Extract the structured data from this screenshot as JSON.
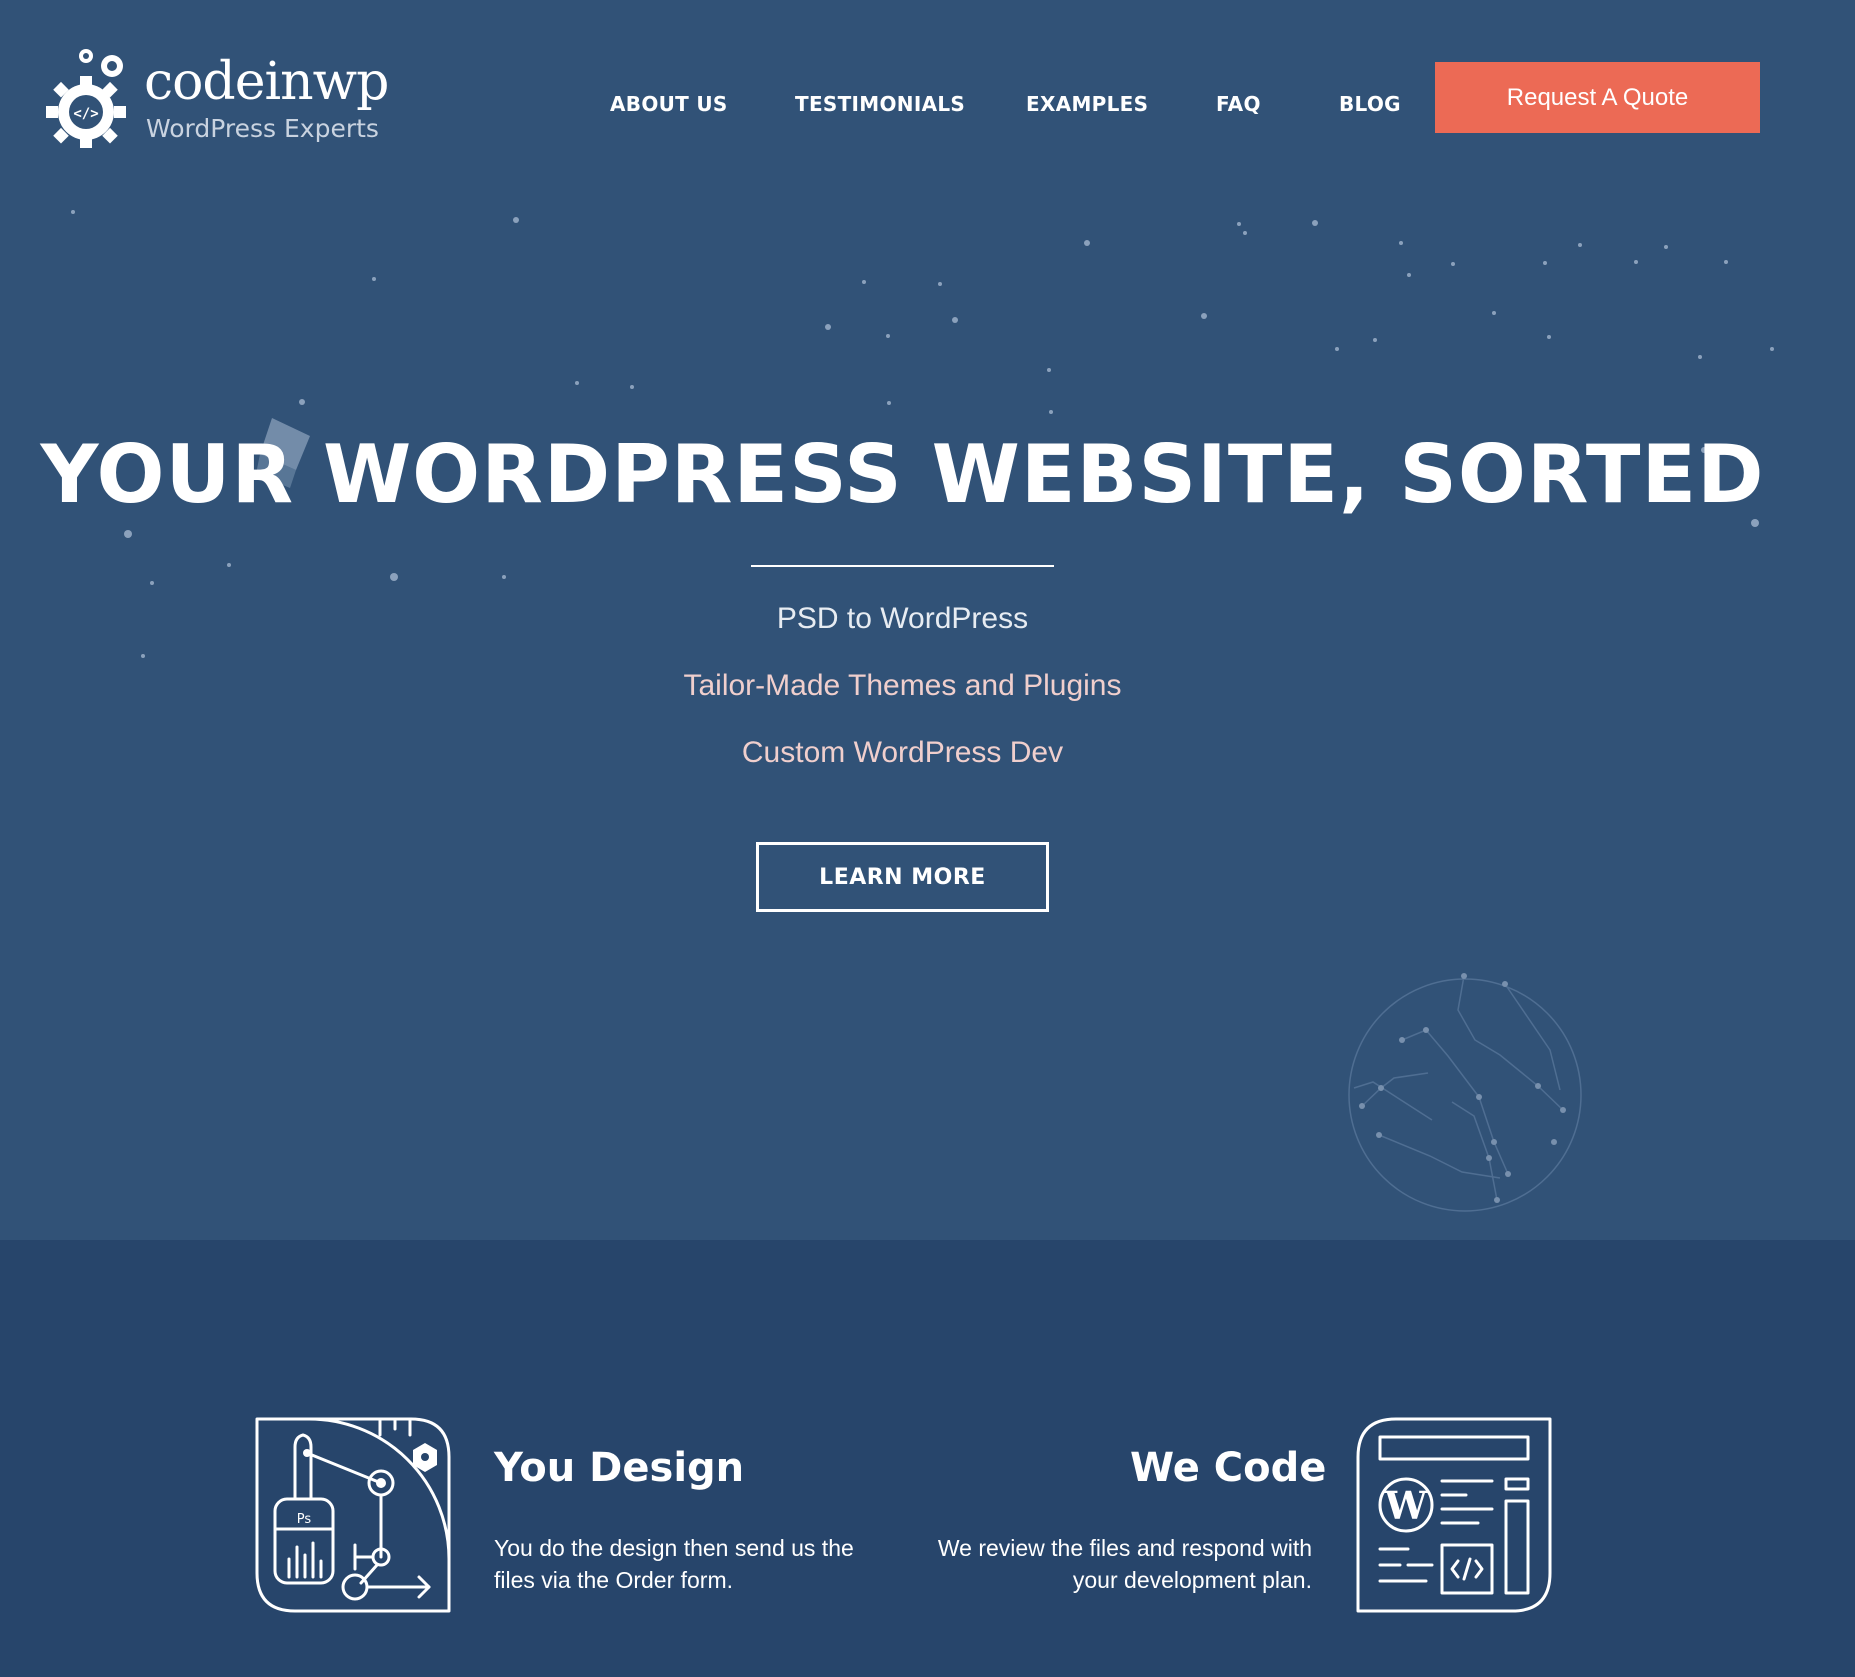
{
  "brand": {
    "name": "codeinwp",
    "tagline": "WordPress Experts"
  },
  "nav": {
    "items": [
      "ABOUT US",
      "TESTIMONIALS",
      "EXAMPLES",
      "FAQ",
      "BLOG"
    ],
    "cta_label": "Request A Quote"
  },
  "hero": {
    "title": "YOUR WORDPRESS WEBSITE, SORTED",
    "services": [
      "PSD to WordPress",
      "Tailor-Made Themes and Plugins",
      "Custom WordPress Dev"
    ],
    "button_label": "LEARN MORE"
  },
  "features": [
    {
      "title": "You Design",
      "text": "You do the design then send us the files via the Order form.",
      "icon": "design-tools-icon"
    },
    {
      "title": "We Code",
      "text": "We review the files and respond with your development plan.",
      "icon": "wordpress-code-icon"
    }
  ],
  "colors": {
    "hero_bg": "#315277",
    "features_bg": "#27456b",
    "accent": "#ec6a55"
  }
}
